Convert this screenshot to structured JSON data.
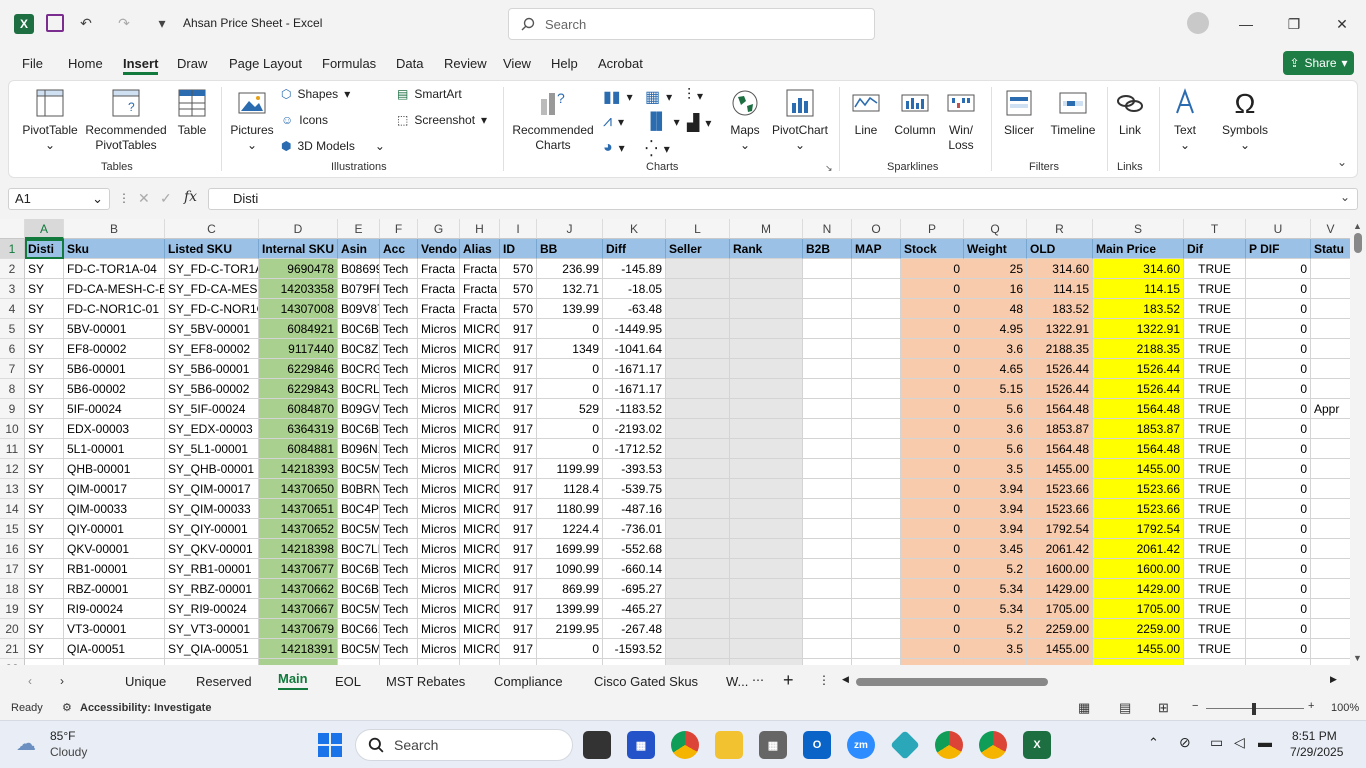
{
  "window": {
    "title": "Ahsan Price Sheet  -  Excel",
    "search_placeholder": "Search",
    "share_label": "Share"
  },
  "menu": [
    "File",
    "Home",
    "Insert",
    "Draw",
    "Page Layout",
    "Formulas",
    "Data",
    "Review",
    "View",
    "Help",
    "Acrobat"
  ],
  "ribbon": {
    "pivot": "PivotTable",
    "rec_pivot": "Recommended\nPivotTables",
    "table": "Table",
    "group_tables": "Tables",
    "pictures": "Pictures",
    "shapes": "Shapes",
    "icons": "Icons",
    "models": "3D Models",
    "smartart": "SmartArt",
    "screenshot": "Screenshot",
    "group_illustrations": "Illustrations",
    "rec_charts": "Recommended\nCharts",
    "maps": "Maps",
    "pivotchart": "PivotChart",
    "group_charts": "Charts",
    "line": "Line",
    "column": "Column",
    "winloss": "Win/\nLoss",
    "group_sparklines": "Sparklines",
    "slicer": "Slicer",
    "timeline": "Timeline",
    "group_filters": "Filters",
    "link": "Link",
    "group_links": "Links",
    "text": "Text",
    "symbols": "Symbols"
  },
  "formula": {
    "namebox": "A1",
    "value": "Disti"
  },
  "columns": [
    "A",
    "B",
    "C",
    "D",
    "E",
    "F",
    "G",
    "H",
    "I",
    "J",
    "K",
    "L",
    "M",
    "N",
    "O",
    "P",
    "Q",
    "R",
    "S",
    "T",
    "U",
    "V"
  ],
  "headers": [
    "Disti",
    "Sku",
    "Listed SKU",
    "Internal SKU",
    "Asin",
    "Acc",
    "Vendo",
    "Alias",
    "ID",
    "BB",
    "Diff",
    "Seller",
    "Rank",
    "B2B",
    "MAP",
    "Stock",
    "Weight",
    "OLD",
    "Main Price",
    "Dif",
    "P DIF",
    "Statu"
  ],
  "rows": [
    [
      "SY",
      "FD-C-TOR1A-04",
      "SY_FD-C-TOR1A",
      "9690478",
      "B08699",
      "Tech",
      "Fracta",
      "Fracta",
      "570",
      "236.99",
      "-145.89",
      "",
      "",
      "",
      "",
      "0",
      "25",
      "314.60",
      "314.60",
      "TRUE",
      "0",
      ""
    ],
    [
      "SY",
      "FD-CA-MESH-C-E",
      "SY_FD-CA-MESH",
      "14203358",
      "B079FF",
      "Tech",
      "Fracta",
      "Fracta",
      "570",
      "132.71",
      "-18.05",
      "",
      "",
      "",
      "",
      "0",
      "16",
      "114.15",
      "114.15",
      "TRUE",
      "0",
      ""
    ],
    [
      "SY",
      "FD-C-NOR1C-01",
      "SY_FD-C-NOR1C",
      "14307008",
      "B09V87",
      "Tech",
      "Fracta",
      "Fracta",
      "570",
      "139.99",
      "-63.48",
      "",
      "",
      "",
      "",
      "0",
      "48",
      "183.52",
      "183.52",
      "TRUE",
      "0",
      ""
    ],
    [
      "SY",
      "5BV-00001",
      "SY_5BV-00001",
      "6084921",
      "B0C6BI",
      "Tech",
      "Micros",
      "MICRO",
      "917",
      "0",
      "-1449.95",
      "",
      "",
      "",
      "",
      "0",
      "4.95",
      "1322.91",
      "1322.91",
      "TRUE",
      "0",
      ""
    ],
    [
      "SY",
      "EF8-00002",
      "SY_EF8-00002",
      "9117440",
      "B0C8ZC",
      "Tech",
      "Micros",
      "MICRO",
      "917",
      "1349",
      "-1041.64",
      "",
      "",
      "",
      "",
      "0",
      "3.6",
      "2188.35",
      "2188.35",
      "TRUE",
      "0",
      ""
    ],
    [
      "SY",
      "5B6-00001",
      "SY_5B6-00001",
      "6229846",
      "B0CRG",
      "Tech",
      "Micros",
      "MICRO",
      "917",
      "0",
      "-1671.17",
      "",
      "",
      "",
      "",
      "0",
      "4.65",
      "1526.44",
      "1526.44",
      "TRUE",
      "0",
      ""
    ],
    [
      "SY",
      "5B6-00002",
      "SY_5B6-00002",
      "6229843",
      "B0CRLS",
      "Tech",
      "Micros",
      "MICRO",
      "917",
      "0",
      "-1671.17",
      "",
      "",
      "",
      "",
      "0",
      "5.15",
      "1526.44",
      "1526.44",
      "TRUE",
      "0",
      ""
    ],
    [
      "SY",
      "5IF-00024",
      "SY_5IF-00024",
      "6084870",
      "B09GVS",
      "Tech",
      "Micros",
      "MICRO",
      "917",
      "529",
      "-1183.52",
      "",
      "",
      "",
      "",
      "0",
      "5.6",
      "1564.48",
      "1564.48",
      "TRUE",
      "0",
      "Appr"
    ],
    [
      "SY",
      "EDX-00003",
      "SY_EDX-00003",
      "6364319",
      "B0C6BI",
      "Tech",
      "Micros",
      "MICRO",
      "917",
      "0",
      "-2193.02",
      "",
      "",
      "",
      "",
      "0",
      "3.6",
      "1853.87",
      "1853.87",
      "TRUE",
      "0",
      ""
    ],
    [
      "SY",
      "5L1-00001",
      "SY_5L1-00001",
      "6084881",
      "B096N1",
      "Tech",
      "Micros",
      "MICRO",
      "917",
      "0",
      "-1712.52",
      "",
      "",
      "",
      "",
      "0",
      "5.6",
      "1564.48",
      "1564.48",
      "TRUE",
      "0",
      ""
    ],
    [
      "SY",
      "QHB-00001",
      "SY_QHB-00001",
      "14218393",
      "B0C5M",
      "Tech",
      "Micros",
      "MICRO",
      "917",
      "1199.99",
      "-393.53",
      "",
      "",
      "",
      "",
      "0",
      "3.5",
      "1455.00",
      "1455.00",
      "TRUE",
      "0",
      ""
    ],
    [
      "SY",
      "QIM-00017",
      "SY_QIM-00017",
      "14370650",
      "B0BRN",
      "Tech",
      "Micros",
      "MICRO",
      "917",
      "1128.4",
      "-539.75",
      "",
      "",
      "",
      "",
      "0",
      "3.94",
      "1523.66",
      "1523.66",
      "TRUE",
      "0",
      ""
    ],
    [
      "SY",
      "QIM-00033",
      "SY_QIM-00033",
      "14370651",
      "B0C4PY",
      "Tech",
      "Micros",
      "MICRO",
      "917",
      "1180.99",
      "-487.16",
      "",
      "",
      "",
      "",
      "0",
      "3.94",
      "1523.66",
      "1523.66",
      "TRUE",
      "0",
      ""
    ],
    [
      "SY",
      "QIY-00001",
      "SY_QIY-00001",
      "14370652",
      "B0C5M",
      "Tech",
      "Micros",
      "MICRO",
      "917",
      "1224.4",
      "-736.01",
      "",
      "",
      "",
      "",
      "0",
      "3.94",
      "1792.54",
      "1792.54",
      "TRUE",
      "0",
      ""
    ],
    [
      "SY",
      "QKV-00001",
      "SY_QKV-00001",
      "14218398",
      "B0C7LH",
      "Tech",
      "Micros",
      "MICRO",
      "917",
      "1699.99",
      "-552.68",
      "",
      "",
      "",
      "",
      "0",
      "3.45",
      "2061.42",
      "2061.42",
      "TRUE",
      "0",
      ""
    ],
    [
      "SY",
      "RB1-00001",
      "SY_RB1-00001",
      "14370677",
      "B0C6B3",
      "Tech",
      "Micros",
      "MICRO",
      "917",
      "1090.99",
      "-660.14",
      "",
      "",
      "",
      "",
      "0",
      "5.2",
      "1600.00",
      "1600.00",
      "TRUE",
      "0",
      ""
    ],
    [
      "SY",
      "RBZ-00001",
      "SY_RBZ-00001",
      "14370662",
      "B0C6B3",
      "Tech",
      "Micros",
      "MICRO",
      "917",
      "869.99",
      "-695.27",
      "",
      "",
      "",
      "",
      "0",
      "5.34",
      "1429.00",
      "1429.00",
      "TRUE",
      "0",
      ""
    ],
    [
      "SY",
      "RI9-00024",
      "SY_RI9-00024",
      "14370667",
      "B0C5M",
      "Tech",
      "Micros",
      "MICRO",
      "917",
      "1399.99",
      "-465.27",
      "",
      "",
      "",
      "",
      "0",
      "5.34",
      "1705.00",
      "1705.00",
      "TRUE",
      "0",
      ""
    ],
    [
      "SY",
      "VT3-00001",
      "SY_VT3-00001",
      "14370679",
      "B0C661",
      "Tech",
      "Micros",
      "MICRO",
      "917",
      "2199.95",
      "-267.48",
      "",
      "",
      "",
      "",
      "0",
      "5.2",
      "2259.00",
      "2259.00",
      "TRUE",
      "0",
      ""
    ],
    [
      "SY",
      "QIA-00051",
      "SY_QIA-00051",
      "14218391",
      "B0C5M",
      "Tech",
      "Micros",
      "MICRO",
      "917",
      "0",
      "-1593.52",
      "",
      "",
      "",
      "",
      "0",
      "3.5",
      "1455.00",
      "1455.00",
      "TRUE",
      "0",
      ""
    ]
  ],
  "sheets": [
    "Unique",
    "Reserved",
    "Main",
    "EOL",
    "MST Rebates",
    "Compliance",
    "Cisco Gated Skus",
    "W..."
  ],
  "status": {
    "ready": "Ready",
    "accessibility": "Accessibility: Investigate",
    "zoom": "100%"
  },
  "taskbar": {
    "temp": "85°F",
    "weather": "Cloudy",
    "search": "Search",
    "time": "8:51 PM",
    "date": "7/29/2025"
  },
  "colors": {
    "header_blue": "#9bc2e6",
    "green": "#a9d08e",
    "salmon": "#f8cbad",
    "yellow": "#ffff00",
    "gray": "#e7e6e6",
    "excel_green": "#117a3c"
  }
}
